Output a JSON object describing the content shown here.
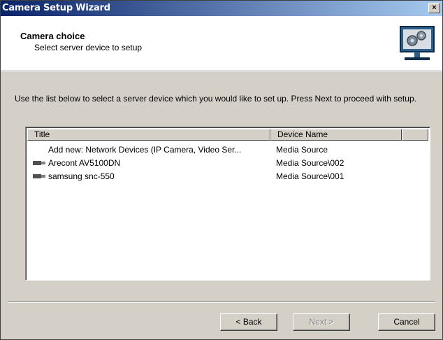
{
  "window": {
    "title": "Camera Setup Wizard",
    "close_glyph": "×"
  },
  "header": {
    "title": "Camera choice",
    "subtitle": "Select server device to setup",
    "icon": "gears-monitor-icon"
  },
  "description": "Use the list below to select a server device which you would like to set up. Press Next to proceed with setup.",
  "list": {
    "columns": [
      "Title",
      "Device Name"
    ],
    "rows": [
      {
        "title": "Add new: Network Devices (IP Camera, Video Ser...",
        "device": "Media Source",
        "icon": ""
      },
      {
        "title": "Arecont AV5100DN",
        "device": "Media Source\\002",
        "icon": "camera-icon"
      },
      {
        "title": "samsung snc-550",
        "device": "Media Source\\001",
        "icon": "camera-icon"
      }
    ]
  },
  "buttons": {
    "back": "< Back",
    "next": "Next >",
    "cancel": "Cancel"
  }
}
